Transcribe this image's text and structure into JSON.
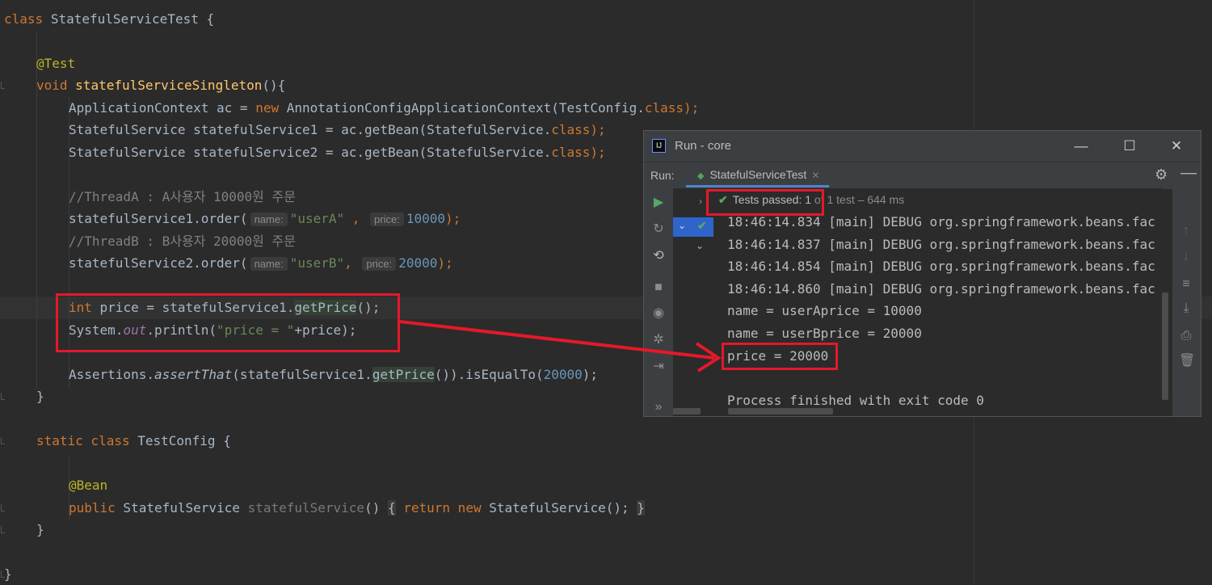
{
  "editor": {
    "l1": {
      "kw": "class",
      "name": "StatefulServiceTest",
      "rest": " {"
    },
    "l2": {
      "ann": "@Test"
    },
    "l3": {
      "kw": "void",
      "fn": "statefulServiceSingleton",
      "rest": "(){"
    },
    "l4": {
      "a": "ApplicationContext ac = ",
      "kw": "new",
      "b": " AnnotationConfigApplicationContext(TestConfig.",
      "kw2": "class",
      "c": ");"
    },
    "l5": {
      "a": "StatefulService statefulService1 = ac.getBean(StatefulService.",
      "kw": "class",
      "c": ");"
    },
    "l6": {
      "a": "StatefulService statefulService2 = ac.getBean(StatefulService.",
      "kw": "class",
      "c": ");"
    },
    "l7": {
      "comment": "//ThreadA : A사용자 10000원 주문"
    },
    "l8": {
      "a": "statefulService1.order(",
      "hint1": "name:",
      "str": "\"userA\"",
      "sep": " , ",
      "hint2": "price:",
      "num": "10000",
      "c": ");"
    },
    "l9": {
      "comment": "//ThreadB : B사용자 20000원 주문"
    },
    "l10": {
      "a": "statefulService2.order(",
      "hint1": "name:",
      "str": "\"userB\"",
      "sep": ", ",
      "hint2": "price:",
      "num": "20000",
      "c": ");"
    },
    "l11": {
      "kw": "int",
      "a": " price = statefulService1.",
      "hl": "getPrice",
      "c": "();"
    },
    "l12": {
      "a": "System.",
      "field": "out",
      "b": ".println(",
      "str": "\"price = \"",
      "c": "+price);"
    },
    "l13": {
      "a": "Assertions.",
      "it": "assertThat",
      "b": "(statefulService1.",
      "hl": "getPrice",
      "c": "()).isEqualTo(",
      "num": "20000",
      "d": ");"
    },
    "l14": {
      "rest": "}"
    },
    "l15": {
      "kw": "static class",
      "rest": " TestConfig {"
    },
    "l16": {
      "ann": "@Bean"
    },
    "l17": {
      "kw": "public",
      "a": " StatefulService ",
      "gray": "statefulService",
      "b": "()",
      "brace1": "{",
      "kw2": "return new",
      "c": " StatefulService();",
      "brace2": "}"
    },
    "l18": {
      "rest": "}"
    },
    "l19": {
      "rest": "}"
    }
  },
  "run_window": {
    "title": "Run - core",
    "minimize_glyph": "—",
    "maximize_glyph": "☐",
    "close_glyph": "✕",
    "run_label": "Run:",
    "tab_label": "StatefulServiceTest",
    "status_passed": "Tests passed: 1",
    "status_rest": "of 1 test – 644 ms",
    "console_lines": [
      "18:46:14.834 [main] DEBUG org.springframework.beans.fac",
      "18:46:14.837 [main] DEBUG org.springframework.beans.fac",
      "18:46:14.854 [main] DEBUG org.springframework.beans.fac",
      "18:46:14.860 [main] DEBUG org.springframework.beans.fac",
      "name = userAprice = 10000",
      "name = userBprice = 20000",
      "price = 20000",
      "",
      "Process finished with exit code 0"
    ]
  },
  "colors": {
    "annotation_box": "#e3192a",
    "pass_check": "#59a869",
    "selected_tab_underline": "#4a88c7"
  }
}
